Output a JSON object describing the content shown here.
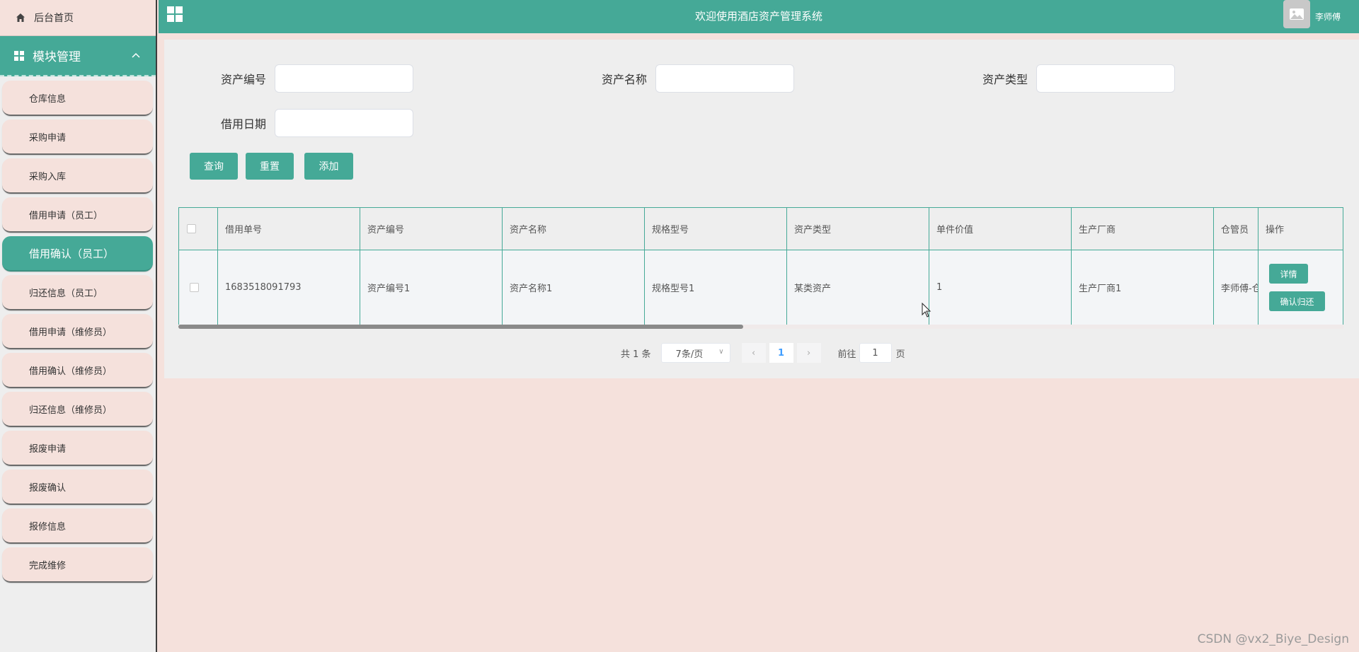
{
  "sidebar": {
    "home_label": "后台首页",
    "module_label": "模块管理",
    "items": [
      {
        "label": "仓库信息"
      },
      {
        "label": "采购申请"
      },
      {
        "label": "采购入库"
      },
      {
        "label": "借用申请（员工）"
      },
      {
        "label": "借用确认（员工）",
        "active": true
      },
      {
        "label": "归还信息（员工）"
      },
      {
        "label": "借用申请（维修员）"
      },
      {
        "label": "借用确认（维修员）"
      },
      {
        "label": "归还信息（维修员）"
      },
      {
        "label": "报废申请"
      },
      {
        "label": "报废确认"
      },
      {
        "label": "报修信息"
      },
      {
        "label": "完成维修"
      }
    ]
  },
  "header": {
    "title": "欢迎使用酒店资产管理系统",
    "user": "李师傅"
  },
  "search": {
    "asset_no_label": "资产编号",
    "asset_name_label": "资产名称",
    "asset_type_label": "资产类型",
    "borrow_date_label": "借用日期",
    "query_label": "查询",
    "reset_label": "重置",
    "add_label": "添加"
  },
  "table": {
    "headers": [
      "借用单号",
      "资产编号",
      "资产名称",
      "规格型号",
      "资产类型",
      "单件价值",
      "生产厂商",
      "仓管员",
      "操作"
    ],
    "rows": [
      {
        "borrow_no": "1683518091793",
        "asset_no": "资产编号1",
        "asset_name": "资产名称1",
        "spec": "规格型号1",
        "asset_type": "某类资产",
        "unit_value": "1",
        "manufacturer": "生产厂商1",
        "keeper": "李师傅-仓",
        "detail_label": "详情",
        "confirm_return_label": "确认归还"
      }
    ]
  },
  "pagination": {
    "total": "共 1 条",
    "page_size": "7条/页",
    "current_page": "1",
    "goto_label": "前往",
    "goto_value": "1",
    "page_unit": "页"
  },
  "watermark": "CSDN @vx2_Biye_Design",
  "colors": {
    "primary": "#45a997",
    "background": "#f5e1dc",
    "panel": "#eeeeee"
  }
}
